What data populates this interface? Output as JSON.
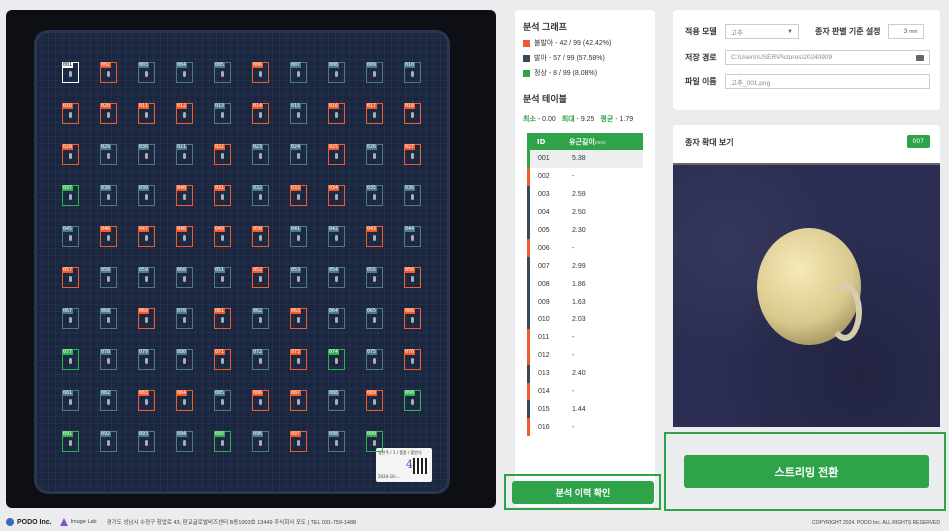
{
  "plate": {
    "cells": [
      {
        "id": "001",
        "s": "sel"
      },
      {
        "id": "002",
        "s": "germ"
      },
      {
        "id": "003",
        "s": "root"
      },
      {
        "id": "004",
        "s": "root"
      },
      {
        "id": "005",
        "s": "root"
      },
      {
        "id": "006",
        "s": "germ"
      },
      {
        "id": "007",
        "s": "root"
      },
      {
        "id": "008",
        "s": "root"
      },
      {
        "id": "009",
        "s": "root"
      },
      {
        "id": "010",
        "s": "root"
      },
      {
        "id": "016",
        "s": "germ"
      },
      {
        "id": "020",
        "s": "germ"
      },
      {
        "id": "011",
        "s": "germ"
      },
      {
        "id": "012",
        "s": "germ"
      },
      {
        "id": "013",
        "s": "root"
      },
      {
        "id": "014",
        "s": "germ"
      },
      {
        "id": "015",
        "s": "root"
      },
      {
        "id": "016",
        "s": "germ"
      },
      {
        "id": "017",
        "s": "germ"
      },
      {
        "id": "018",
        "s": "germ"
      },
      {
        "id": "028",
        "s": "germ"
      },
      {
        "id": "029",
        "s": "root"
      },
      {
        "id": "030",
        "s": "root"
      },
      {
        "id": "021",
        "s": "root"
      },
      {
        "id": "022",
        "s": "germ"
      },
      {
        "id": "023",
        "s": "root"
      },
      {
        "id": "024",
        "s": "root"
      },
      {
        "id": "025",
        "s": "germ"
      },
      {
        "id": "026",
        "s": "root"
      },
      {
        "id": "027",
        "s": "germ"
      },
      {
        "id": "037",
        "s": "norm"
      },
      {
        "id": "038",
        "s": "root"
      },
      {
        "id": "039",
        "s": "root"
      },
      {
        "id": "040",
        "s": "germ"
      },
      {
        "id": "031",
        "s": "germ"
      },
      {
        "id": "032",
        "s": "root"
      },
      {
        "id": "033",
        "s": "germ"
      },
      {
        "id": "034",
        "s": "germ"
      },
      {
        "id": "035",
        "s": "root"
      },
      {
        "id": "036",
        "s": "root"
      },
      {
        "id": "045",
        "s": "root"
      },
      {
        "id": "046",
        "s": "germ"
      },
      {
        "id": "047",
        "s": "germ"
      },
      {
        "id": "048",
        "s": "germ"
      },
      {
        "id": "049",
        "s": "germ"
      },
      {
        "id": "050",
        "s": "germ"
      },
      {
        "id": "041",
        "s": "root"
      },
      {
        "id": "042",
        "s": "root"
      },
      {
        "id": "043",
        "s": "germ"
      },
      {
        "id": "044",
        "s": "root"
      },
      {
        "id": "057",
        "s": "germ"
      },
      {
        "id": "058",
        "s": "root"
      },
      {
        "id": "059",
        "s": "root"
      },
      {
        "id": "060",
        "s": "root"
      },
      {
        "id": "051",
        "s": "root"
      },
      {
        "id": "052",
        "s": "germ"
      },
      {
        "id": "053",
        "s": "root"
      },
      {
        "id": "054",
        "s": "root"
      },
      {
        "id": "055",
        "s": "root"
      },
      {
        "id": "056",
        "s": "germ"
      },
      {
        "id": "067",
        "s": "root"
      },
      {
        "id": "068",
        "s": "root"
      },
      {
        "id": "069",
        "s": "germ"
      },
      {
        "id": "070",
        "s": "root"
      },
      {
        "id": "061",
        "s": "germ"
      },
      {
        "id": "062",
        "s": "root"
      },
      {
        "id": "063",
        "s": "germ"
      },
      {
        "id": "064",
        "s": "root"
      },
      {
        "id": "065",
        "s": "root"
      },
      {
        "id": "066",
        "s": "germ"
      },
      {
        "id": "077",
        "s": "norm"
      },
      {
        "id": "078",
        "s": "root"
      },
      {
        "id": "079",
        "s": "root"
      },
      {
        "id": "080",
        "s": "root"
      },
      {
        "id": "071",
        "s": "germ"
      },
      {
        "id": "072",
        "s": "root"
      },
      {
        "id": "073",
        "s": "germ"
      },
      {
        "id": "074",
        "s": "norm"
      },
      {
        "id": "075",
        "s": "root"
      },
      {
        "id": "076",
        "s": "germ"
      },
      {
        "id": "081",
        "s": "root"
      },
      {
        "id": "082",
        "s": "root"
      },
      {
        "id": "083",
        "s": "germ"
      },
      {
        "id": "084",
        "s": "germ"
      },
      {
        "id": "085",
        "s": "root"
      },
      {
        "id": "086",
        "s": "germ"
      },
      {
        "id": "087",
        "s": "germ"
      },
      {
        "id": "088",
        "s": "root"
      },
      {
        "id": "089",
        "s": "germ"
      },
      {
        "id": "090",
        "s": "norm"
      },
      {
        "id": "091",
        "s": "norm"
      },
      {
        "id": "092",
        "s": "root"
      },
      {
        "id": "093",
        "s": "root"
      },
      {
        "id": "094",
        "s": "root"
      },
      {
        "id": "095",
        "s": "norm"
      },
      {
        "id": "096",
        "s": "root"
      },
      {
        "id": "097",
        "s": "germ"
      },
      {
        "id": "098",
        "s": "root"
      },
      {
        "id": "099",
        "s": "norm"
      }
    ],
    "label_text": "영안주 / 1 / 품종 / 품번식",
    "label_line2": "2024-10-...",
    "label_num": "4"
  },
  "graph": {
    "title": "분석 그래프",
    "legend": [
      {
        "text": "불발아 - 42 / 99 (42.42%)",
        "color": "#ef5b2a"
      },
      {
        "text": "발아 - 57 / 99 (57.58%)",
        "color": "#334a5c"
      },
      {
        "text": "정상 - 8 / 99 (8.08%)",
        "color": "#2fa34a"
      }
    ]
  },
  "table": {
    "title": "분석 테이블",
    "min_label": "최소",
    "min_value": "- 0.00",
    "max_label": "최대",
    "max_value": "- 9.25",
    "avg_label": "평균",
    "avg_value": "- 1.79",
    "col_id": "ID",
    "col_len": "유근길이",
    "col_unit": "(mm)",
    "rows": [
      {
        "id": "001",
        "v": "5.38",
        "c": "#2fa34a"
      },
      {
        "id": "002",
        "v": "-",
        "c": "#ef5b2a"
      },
      {
        "id": "003",
        "v": "2.59",
        "c": "#334a5c"
      },
      {
        "id": "004",
        "v": "2.50",
        "c": "#334a5c"
      },
      {
        "id": "005",
        "v": "2.30",
        "c": "#334a5c"
      },
      {
        "id": "006",
        "v": "-",
        "c": "#ef5b2a"
      },
      {
        "id": "007",
        "v": "2.99",
        "c": "#334a5c"
      },
      {
        "id": "008",
        "v": "1.86",
        "c": "#334a5c"
      },
      {
        "id": "009",
        "v": "1.63",
        "c": "#334a5c"
      },
      {
        "id": "010",
        "v": "2.03",
        "c": "#334a5c"
      },
      {
        "id": "011",
        "v": "-",
        "c": "#ef5b2a"
      },
      {
        "id": "012",
        "v": "-",
        "c": "#ef5b2a"
      },
      {
        "id": "013",
        "v": "2.40",
        "c": "#334a5c"
      },
      {
        "id": "014",
        "v": "-",
        "c": "#ef5b2a"
      },
      {
        "id": "015",
        "v": "1.44",
        "c": "#334a5c"
      },
      {
        "id": "016",
        "v": "-",
        "c": "#ef5b2a"
      }
    ],
    "history_button": "분석 이력 확인"
  },
  "settings": {
    "model_label": "적용 모델",
    "model_value": "고추",
    "criteria_label": "종자 판별 기준 설정",
    "criteria_value": "3",
    "criteria_unit": "mm",
    "path_label": "저장 경로",
    "path_value": "C:\\Users\\USER\\Pictures\\20240909",
    "file_label": "파일 이름",
    "file_value": "고추_001.png"
  },
  "zoom": {
    "title": "종자 확대 보기",
    "badge": "007"
  },
  "stream_button": "스트리밍 전환",
  "footer": {
    "brand1": "PODO Inc.",
    "brand2": "Image Lab",
    "address": "경기도 성남시 수정구 창업로 43, 판교글로벌비즈센터 B동1003호 13449 주식회사 포도 | TEL 031-759-1488",
    "copyright": "COPYRIGHT 2024. PODO Inc. ALL RIGHTS RESERVED"
  }
}
